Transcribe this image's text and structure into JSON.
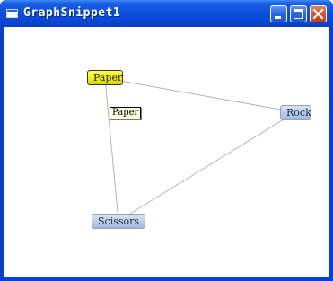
{
  "window": {
    "title": "GraphSnippet1",
    "controls": {
      "minimize": "minimize",
      "maximize": "maximize",
      "close": "close"
    }
  },
  "graph": {
    "nodes": [
      {
        "id": "paper",
        "label": "Paper",
        "state": "selected",
        "color": "#f0f000"
      },
      {
        "id": "rock",
        "label": "Rock",
        "state": "normal",
        "color": "#b7cbe5"
      },
      {
        "id": "scissors",
        "label": "Scissors",
        "state": "normal",
        "color": "#b7cbe5"
      }
    ],
    "edges": [
      {
        "from": "paper",
        "to": "rock"
      },
      {
        "from": "paper",
        "to": "scissors"
      },
      {
        "from": "rock",
        "to": "scissors"
      }
    ]
  },
  "tooltip": {
    "text": "Paper"
  },
  "colors": {
    "titlebar": "#0a4fdc",
    "edge": "#b4b4b4",
    "selected_node": "#f0f000",
    "node": "#b7cbe5",
    "tooltip_bg": "#ffffe1"
  }
}
